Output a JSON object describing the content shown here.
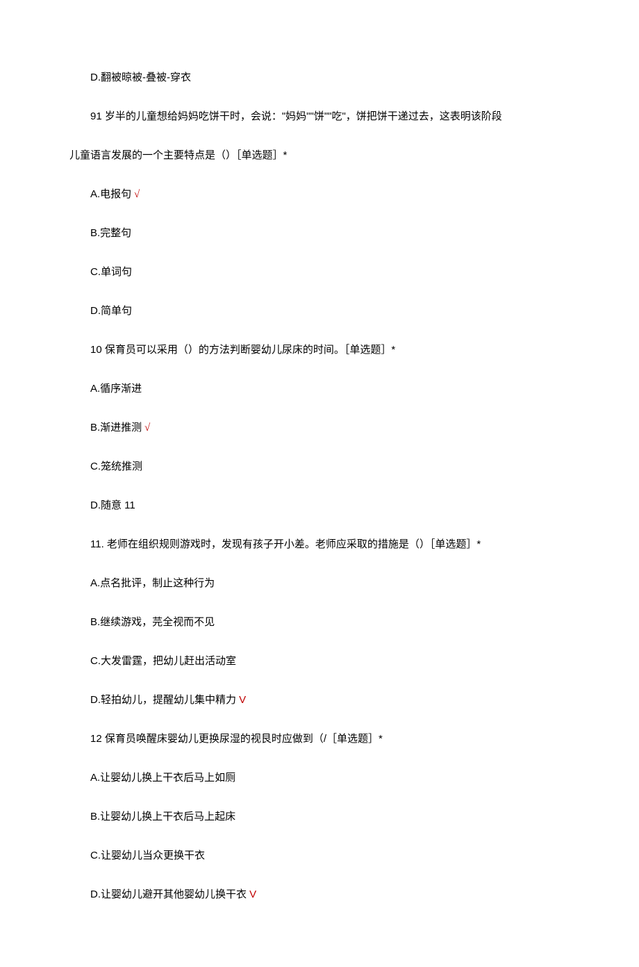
{
  "lines": {
    "l1": "D.翻被晾被-叠被-穿衣",
    "l2": "91 岁半的儿童想给妈妈吃饼干时，会说：\"妈妈\"\"饼\"\"吃\"，饼把饼干递过去，这表明该阶段",
    "l3": "儿童语言发展的一个主要特点是（）［单选题］*",
    "l4a": "A.电报句",
    "l5": "B.完整句",
    "l6": "C.单词句",
    "l7": "D.简单句",
    "l8": "10 保育员可以采用（）的方法判断婴幼儿尿床的时间。［单选题］*",
    "l9": "A.循序渐进",
    "l10a": "B.渐进推测",
    "l11": "C.笼统推测",
    "l12": "D.随意 11",
    "l13": "11. 老师在组织规则游戏时，发现有孩子开小差。老师应采取的措施是（）［单选题］*",
    "l14": "A.点名批评，制止这种行为",
    "l15": "B.继续游戏，芫全视而不见",
    "l16": "C.大发雷霆，把幼儿赶出活动室",
    "l17a": "D.轻拍幼儿，提醒幼儿集中精力",
    "l18": "12 保育员唤醒床婴幼儿更换尿湿的视艮时应做到（/［单选题］*",
    "l19": "A.让婴幼儿换上干衣后马上如厕",
    "l20": "B.让婴幼儿换上干衣后马上起床",
    "l21": "C.让婴幼儿当众更换干衣",
    "l22a": "D.让婴幼儿避开其他婴幼儿换干衣"
  },
  "marks": {
    "check": " √",
    "v": " V"
  }
}
